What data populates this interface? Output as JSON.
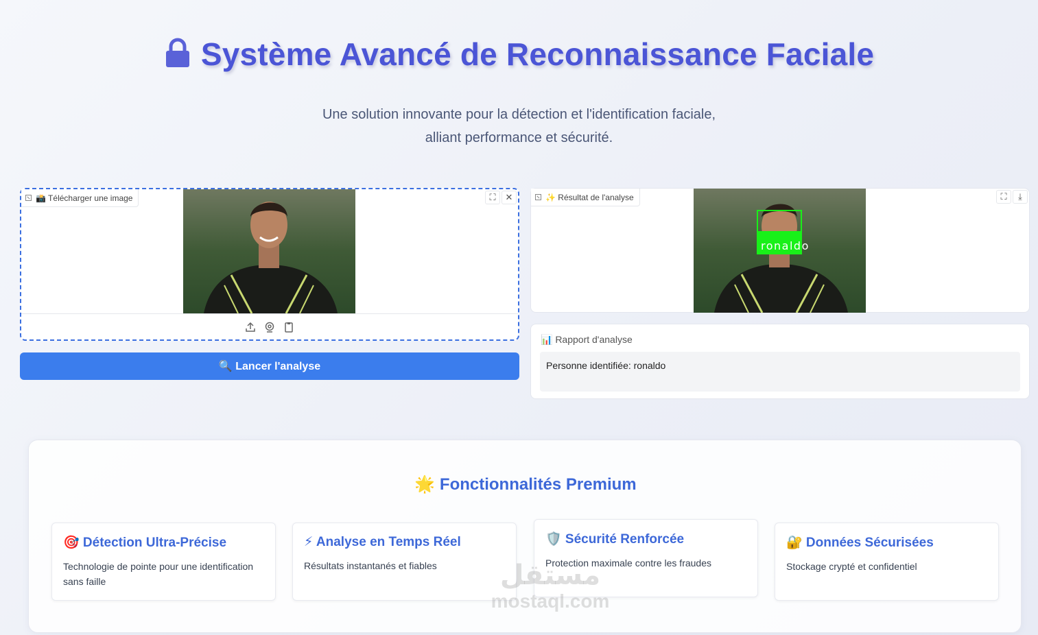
{
  "header": {
    "title": "Système Avancé de Reconnaissance Faciale",
    "subtitle_line1": "Une solution innovante pour la détection et l'identification faciale,",
    "subtitle_line2": "alliant performance et sécurité."
  },
  "input_panel": {
    "label": "📸 Télécharger une image",
    "icons": [
      "upload-icon",
      "webcam-icon",
      "clipboard-icon"
    ],
    "corner_icons": [
      "fullscreen-icon",
      "close-icon"
    ]
  },
  "run_button": {
    "label": "🔍 Lancer l'analyse",
    "color": "#3b7ded"
  },
  "output_panel": {
    "label": "✨ Résultat de l'analyse",
    "detected_label": "ronaldo",
    "box_color": "#19f019",
    "corner_icons": [
      "fullscreen-icon",
      "download-icon"
    ]
  },
  "report": {
    "label": "📊 Rapport d'analyse",
    "text": "Personne identifiée: ronaldo"
  },
  "features": {
    "title": "🌟 Fonctionnalités Premium",
    "cards": [
      {
        "title": "🎯 Détection Ultra-Précise",
        "text": "Technologie de pointe pour une identification sans faille"
      },
      {
        "title": "⚡ Analyse en Temps Réel",
        "text": "Résultats instantanés et fiables"
      },
      {
        "title": "🛡️ Sécurité Renforcée",
        "text": "Protection maximale contre les fraudes"
      },
      {
        "title": "🔐 Données Sécurisées",
        "text": "Stockage crypté et confidentiel"
      }
    ]
  },
  "watermark": {
    "line1": "مستقل",
    "line2": "mostaql.com"
  }
}
